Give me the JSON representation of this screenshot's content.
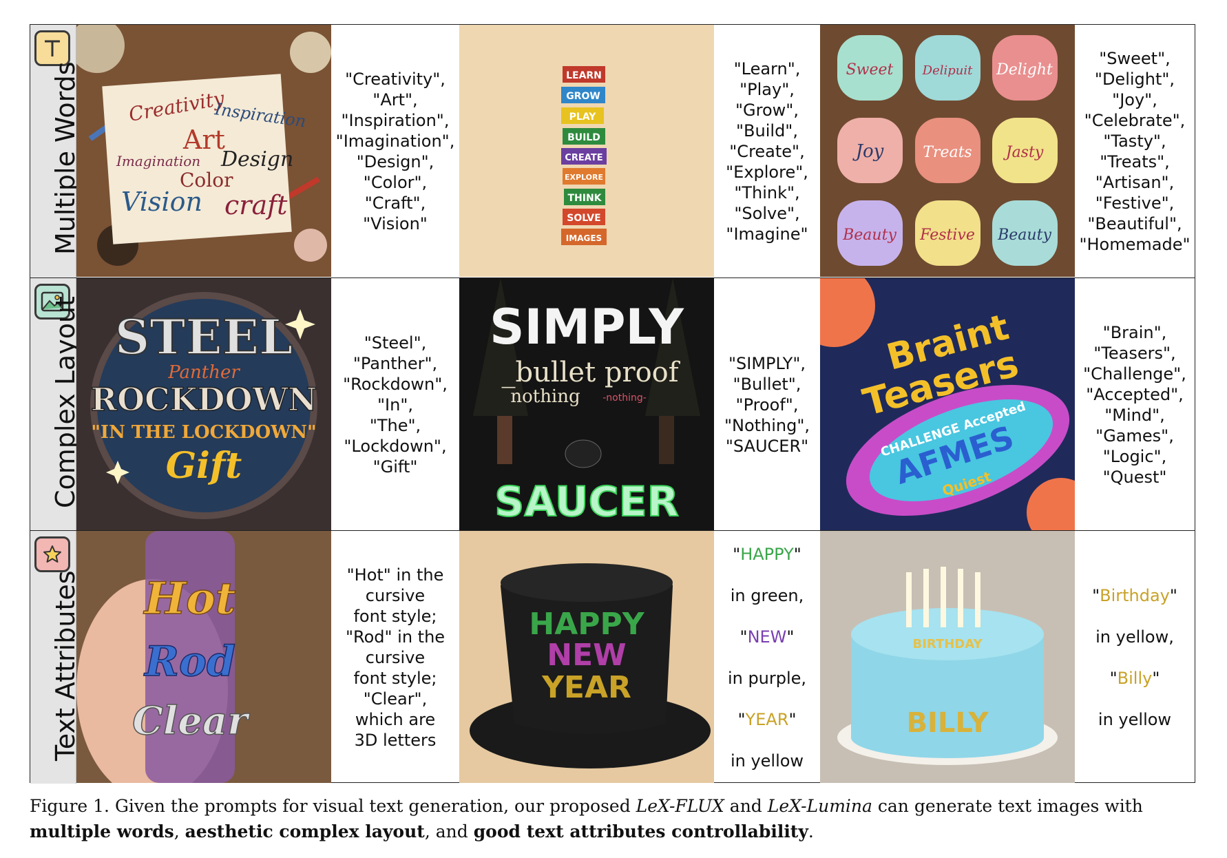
{
  "rows": [
    {
      "label": "Multiple Words",
      "icon": "text-t-icon",
      "cells": [
        {
          "image": "art-supplies-calligraphy-image",
          "words": [
            "Creativity",
            "Art",
            "Imagination",
            "Design",
            "Color",
            "Inspiration",
            "Vision",
            "craft"
          ],
          "prompt": "\"Creativity\",\n\"Art\",\n\"Inspiration\",\n\"Imagination\",\n\"Design\",\n\"Color\",\n\"Craft\",\n\"Vision\""
        },
        {
          "image": "stacked-word-blocks-image",
          "words": [
            "LEARN",
            "GROW",
            "PLAY",
            "BUILD",
            "CREATE",
            "EXPLORE",
            "THINK",
            "SOLVE",
            "IMAGES"
          ],
          "prompt": "\"Learn\",\n\"Play\",\n\"Grow\",\n\"Build\",\n\"Create\",\n\"Explore\",\n\"Think\",\n\"Solve\",\n\"Imagine\""
        },
        {
          "image": "decorated-cookies-image",
          "words": [
            "Sweet",
            "Delipuit",
            "Delight",
            "Joy",
            "Treats",
            "Jasty",
            "Beauty",
            "Festive",
            "Beauty"
          ],
          "prompt": "\"Sweet\",\n\"Delight\",\n\"Joy\",\n\"Celebrate\",\n\"Tasty\",\n\"Treats\",\n\"Artisan\",\n\"Festive\",\n\"Beautiful\",\n\"Homemade\""
        }
      ]
    },
    {
      "label": "Complex Layout",
      "icon": "image-landscape-icon",
      "cells": [
        {
          "image": "steel-panther-badge-image",
          "words": [
            "STEEL",
            "Panther",
            "ROCKDOWN",
            "\"IN THE LOCKDOWN\"",
            "Gift"
          ],
          "prompt": "\"Steel\",\n\"Panther\",\n\"Rockdown\",\n\"In\",\n\"The\",\n\"Lockdown\",\n\"Gift\""
        },
        {
          "image": "concert-stage-neon-image",
          "words": [
            "SIMPLY",
            "bullet proof",
            "nothing",
            "nothing",
            "SAUCER"
          ],
          "prompt": "\"SIMPLY\",\n\"Bullet\",\n\"Proof\",\n\"Nothing\",\n\"SAUCER\""
        },
        {
          "image": "brain-teasers-poster-image",
          "words": [
            "Braint",
            "Teasers",
            "CHALLENGE Accepted",
            "AFMES",
            "Quiest"
          ],
          "prompt": "\"Brain\",\n\"Teasers\",\n\"Challenge\",\n\"Accepted\",\n\"Mind\",\n\"Games\",\n\"Logic\",\n\"Quest\""
        }
      ]
    },
    {
      "label": "Text Attributes",
      "icon": "star-icon",
      "cells": [
        {
          "image": "hand-holding-gem-tube-image",
          "words": [
            "Hot",
            "Rod",
            "Clear"
          ],
          "prompt": "\"Hot\" in the\ncursive\nfont style;\n\"Rod\" in the\ncursive\nfont style;\n\"Clear\",\nwhich are\n3D letters"
        },
        {
          "image": "new-year-top-hat-image",
          "words": [
            "HAPPY",
            "NEW",
            "YEAR"
          ],
          "attr": [
            {
              "pre": "\"",
              "word": "HAPPY",
              "post": "\"",
              "color": "#3aa64a"
            },
            {
              "plain": "in green,"
            },
            {
              "pre": "\"",
              "word": "NEW",
              "post": "\"",
              "color": "#7a3fb0"
            },
            {
              "plain": "in purple,"
            },
            {
              "pre": "\"",
              "word": "YEAR",
              "post": "\"",
              "color": "#c9a227"
            },
            {
              "plain": "in yellow"
            }
          ]
        },
        {
          "image": "birthday-cake-image",
          "words": [
            "BIRTHDAY",
            "BILLY"
          ],
          "attr": [
            {
              "pre": "\"",
              "word": "Birthday",
              "post": "\"",
              "color": "#c9a227"
            },
            {
              "plain": "in yellow,"
            },
            {
              "pre": "\"",
              "word": "Billy",
              "post": "\"",
              "color": "#c9a227"
            },
            {
              "plain": "in yellow"
            }
          ]
        }
      ]
    }
  ],
  "caption": {
    "prefix": "Figure 1. Given the prompts for visual text generation, our proposed ",
    "model1": "LeX-FLUX",
    "and1": " and ",
    "model2": "LeX-Lumina",
    "mid": " can generate text images with ",
    "bold1": "multiple words",
    "sep1": ", ",
    "bold2": "aesthetic complex layout",
    "sep2": ", and ",
    "bold3": "good text attributes controllability",
    "end": "."
  },
  "colors": {
    "green": "#3aa64a",
    "purple": "#7a3fb0",
    "yellow": "#c9a227"
  }
}
